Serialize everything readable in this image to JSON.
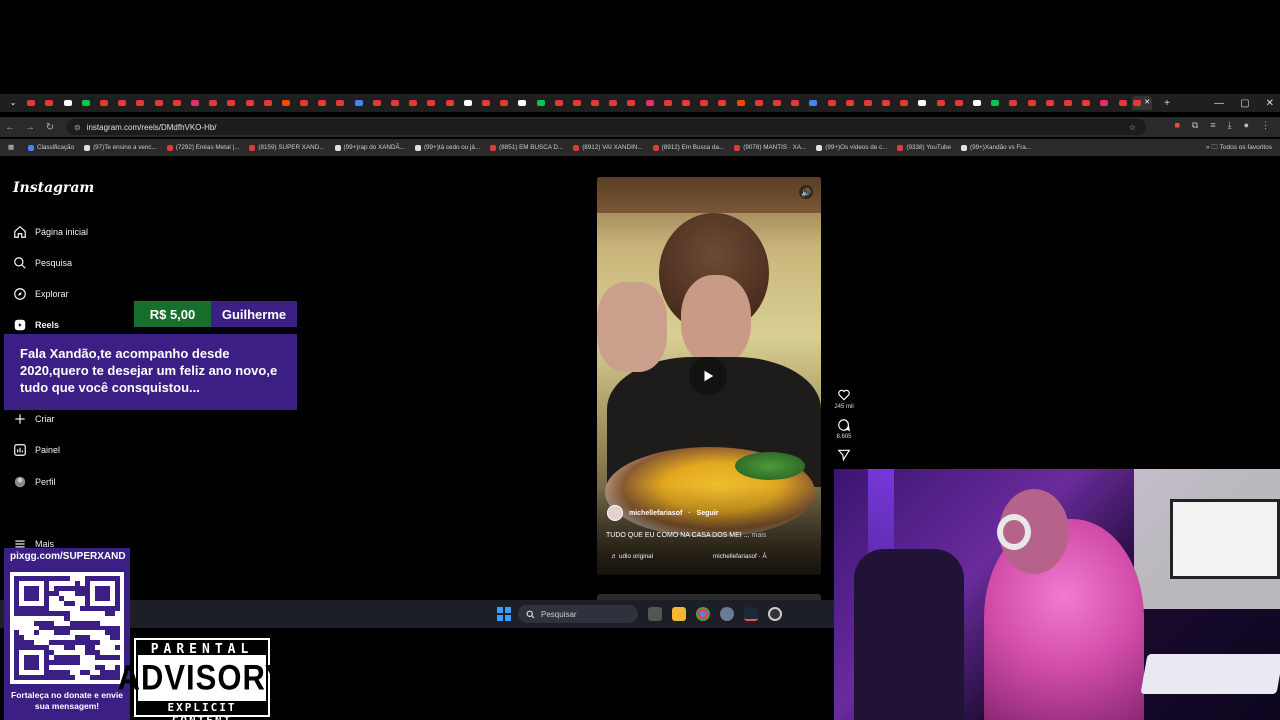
{
  "browser": {
    "url": "instagram.com/reels/DMdfhVKO-Hb/",
    "tabs_count": 62,
    "tab_favicon_colors": [
      "#e53935",
      "#4285f4",
      "#ffffff",
      "#00c853",
      "#e1306c",
      "#ff4500"
    ],
    "bookmarks": [
      {
        "label": "Classificação",
        "color": "#4285f4"
      },
      {
        "label": "(97)Te ensino a venc...",
        "color": "#e0e0e0"
      },
      {
        "label": "(7292) Enéas Metal |...",
        "color": "#e53935"
      },
      {
        "label": "(8159) SUPER XAND...",
        "color": "#e53935"
      },
      {
        "label": "(99+)rap do XANDÃ...",
        "color": "#e0e0e0"
      },
      {
        "label": "(99+)tá cedo ou já...",
        "color": "#e0e0e0"
      },
      {
        "label": "(8851) EM BUSCA D...",
        "color": "#e53935"
      },
      {
        "label": "(8912) VAI XANDIN...",
        "color": "#e53935"
      },
      {
        "label": "(8912) Em Busca da...",
        "color": "#e53935"
      },
      {
        "label": "(9078) MANTIS · XA...",
        "color": "#e53935"
      },
      {
        "label": "(99+)Os vídeos de c...",
        "color": "#e0e0e0"
      },
      {
        "label": "(9338) YouTube",
        "color": "#e53935"
      },
      {
        "label": "(99+)Xandão vs Fra...",
        "color": "#e0e0e0"
      }
    ],
    "favorites_folder": "Todos os favoritos"
  },
  "instagram": {
    "logo": "Instagram",
    "sidebar": [
      {
        "label": "Página inicial",
        "icon": "home-icon"
      },
      {
        "label": "Pesquisa",
        "icon": "search-icon"
      },
      {
        "label": "Explorar",
        "icon": "compass-icon"
      },
      {
        "label": "Reels",
        "icon": "reels-icon"
      },
      {
        "label": "Criar",
        "icon": "plus-icon"
      },
      {
        "label": "Painel",
        "icon": "chart-icon"
      },
      {
        "label": "Perfil",
        "icon": "avatar-icon"
      },
      {
        "label": "Mais",
        "icon": "menu-icon"
      }
    ],
    "reel": {
      "username": "michellefariasof",
      "follow": "Seguir",
      "caption": "TUDO QUE EU COMO NA CASA DOS MEI",
      "caption_more": "mais",
      "audio_label": "udio original",
      "audio_author": "michellefariasof · Á",
      "likes": "245 mil",
      "comments": "8.605"
    }
  },
  "taskbar": {
    "search_placeholder": "Pesquisar"
  },
  "overlay": {
    "donation_amount": "R$ 5,00",
    "donor_name": "Guilherme",
    "donation_message": "Fala Xandão,te acompanho desde 2020,quero te desejar um feliz ano novo,e tudo que você consquistou...",
    "pix_url": "pixgg.com/SUPERXAND",
    "pix_message": "Fortaleça no donate e envie sua mensagem!",
    "advisory_top": "PARENTAL",
    "advisory_mid": "ADVISORY",
    "advisory_bottom": "EXPLICIT CONTENT"
  }
}
